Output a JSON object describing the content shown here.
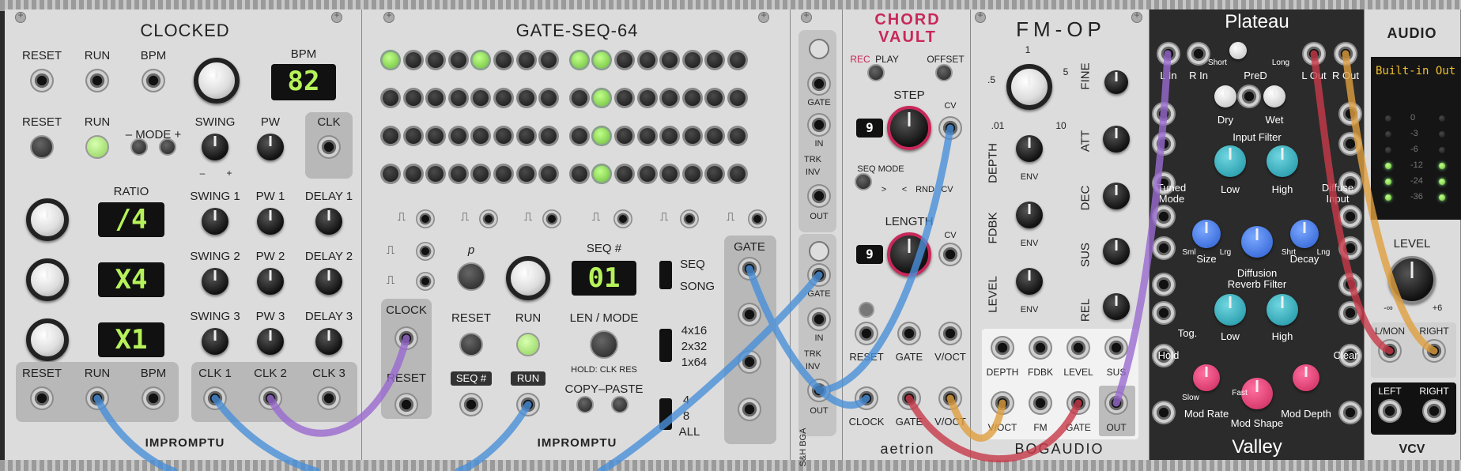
{
  "clocked": {
    "title": "CLOCKED",
    "labels": {
      "reset": "RESET",
      "run": "RUN",
      "bpm": "BPM",
      "bpm_disp": "BPM",
      "mode": "– MODE +",
      "swing": "SWING",
      "pw": "PW",
      "clk": "CLK",
      "ratio": "RATIO",
      "swing1": "SWING 1",
      "pw1": "PW 1",
      "delay1": "DELAY 1",
      "swing2": "SWING 2",
      "pw2": "PW 2",
      "delay2": "DELAY 2",
      "swing3": "SWING 3",
      "pw3": "PW 3",
      "delay3": "DELAY 3",
      "clk1": "CLK 1",
      "clk2": "CLK 2",
      "clk3": "CLK 3",
      "minus": "–",
      "plus": "+"
    },
    "bpm_display": "82",
    "ratio_displays": [
      "/4",
      "X4",
      "X1"
    ],
    "brand": "IMPROMPTU"
  },
  "gateseq": {
    "title": "GATE-SEQ-64",
    "labels": {
      "clock": "CLOCK",
      "reset": "RESET",
      "reset2": "RESET",
      "run": "RUN",
      "seqnum": "SEQ #",
      "seqnum_btn": "SEQ #",
      "run_btn": "RUN",
      "len_mode": "LEN / MODE",
      "hold": "HOLD: CLK RES",
      "copy_paste": "COPY–PASTE",
      "seq": "SEQ",
      "song": "SONG",
      "m4x16": "4x16",
      "m2x32": "2x32",
      "m1x64": "1x64",
      "n4": "4",
      "n8": "8",
      "all": "ALL",
      "gate": "GATE",
      "p": "p"
    },
    "seq_display": "01",
    "grid_on": [
      [
        1,
        0,
        0,
        0,
        1,
        0,
        0,
        0,
        1,
        1,
        0,
        0,
        0,
        0,
        0,
        0
      ],
      [
        0,
        0,
        0,
        0,
        0,
        0,
        0,
        0,
        0,
        1,
        0,
        0,
        0,
        0,
        0,
        0
      ],
      [
        0,
        0,
        0,
        0,
        0,
        0,
        0,
        0,
        0,
        1,
        0,
        0,
        0,
        0,
        0,
        0
      ],
      [
        0,
        0,
        0,
        0,
        0,
        0,
        0,
        0,
        0,
        1,
        0,
        0,
        0,
        0,
        0,
        0
      ]
    ],
    "brand": "IMPROMPTU"
  },
  "sh": {
    "labels": {
      "gate": "GATE",
      "in": "IN",
      "trk": "TRK",
      "inv": "INV",
      "out": "OUT",
      "gate2": "GATE",
      "in2": "IN",
      "trk2": "TRK",
      "inv2": "INV",
      "out2": "OUT"
    },
    "brand": "S&H BGA"
  },
  "chordvault": {
    "title1": "CHORD",
    "title2": "VAULT",
    "labels": {
      "rec": "REC",
      "play": "PLAY",
      "offset": "OFFSET",
      "step": "STEP",
      "cv": "CV",
      "seq_mode": "SEQ MODE",
      "gt": ">",
      "lt": "<",
      "rnd": "RND",
      "cv2": "CV",
      "length": "LENGTH",
      "cv3": "CV",
      "reset": "RESET",
      "gate": "GATE",
      "voct": "V/OCT",
      "clock": "CLOCK",
      "gate2": "GATE",
      "voct2": "V/OCT"
    },
    "step_value": "9",
    "length_value": "9",
    "brand": "aetrion"
  },
  "fmop": {
    "title": "FM-OP",
    "labels": {
      "ratio_1": "1",
      "ratio_5a": ".5",
      "ratio_5b": "5",
      "ratio_01": ".01",
      "ratio_10": "10",
      "fine": "FINE",
      "depth": "DEPTH",
      "att": "ATT",
      "fdbk": "FDBK",
      "dec": "DEC",
      "level": "LEVEL",
      "sus": "SUS",
      "rel": "REL",
      "env1": "ENV",
      "env2": "ENV",
      "env3": "ENV",
      "depth_j": "DEPTH",
      "fdbk_j": "FDBK",
      "level_j": "LEVEL",
      "sus_j": "SUS",
      "voct": "V/OCT",
      "fm": "FM",
      "gate": "GATE",
      "out": "OUT"
    },
    "brand": "BOGAUDIO"
  },
  "plateau": {
    "title": "Plateau",
    "footer": "Valley",
    "labels": {
      "lin": "L In",
      "rin": "R In",
      "short": "Short",
      "pred": "PreD",
      "long": "Long",
      "lout": "L Out",
      "rout": "R Out",
      "dry": "Dry",
      "wet": "Wet",
      "input_filter": "Input Filter",
      "tuned": "Tuned",
      "mode": "Mode",
      "low": "Low",
      "high": "High",
      "diffuse": "Diffuse",
      "input": "Input",
      "sml": "Sml",
      "size": "Size",
      "lrg": "Lrg",
      "shrt": "Shrt",
      "decay": "Decay",
      "lng": "Lng",
      "diffusion": "Diffusion",
      "reverb_filter": "Reverb Filter",
      "tog": "Tog.",
      "low2": "Low",
      "high2": "High",
      "hold": "Hold",
      "clear": "Clear",
      "slow": "Slow",
      "fast": "Fast",
      "mod_rate": "Mod Rate",
      "mod_shape": "Mod Shape",
      "mod_depth": "Mod Depth"
    }
  },
  "audio": {
    "title": "AUDIO",
    "device": "Built-in Out",
    "meter": [
      "0",
      "-3",
      "-6",
      "-12",
      "-24",
      "-36"
    ],
    "labels": {
      "level": "LEVEL",
      "minf": "-∞",
      "p6": "+6",
      "lmon": "L/MON",
      "right": "RIGHT",
      "left": "LEFT",
      "right2": "RIGHT"
    },
    "brand": "VCV"
  },
  "colors": {
    "led_green": "#8ed05a",
    "cable_blue": "#4a90d9",
    "cable_purple": "#9a6ad0",
    "cable_red": "#c83a4a",
    "cable_orange": "#e0a040"
  }
}
